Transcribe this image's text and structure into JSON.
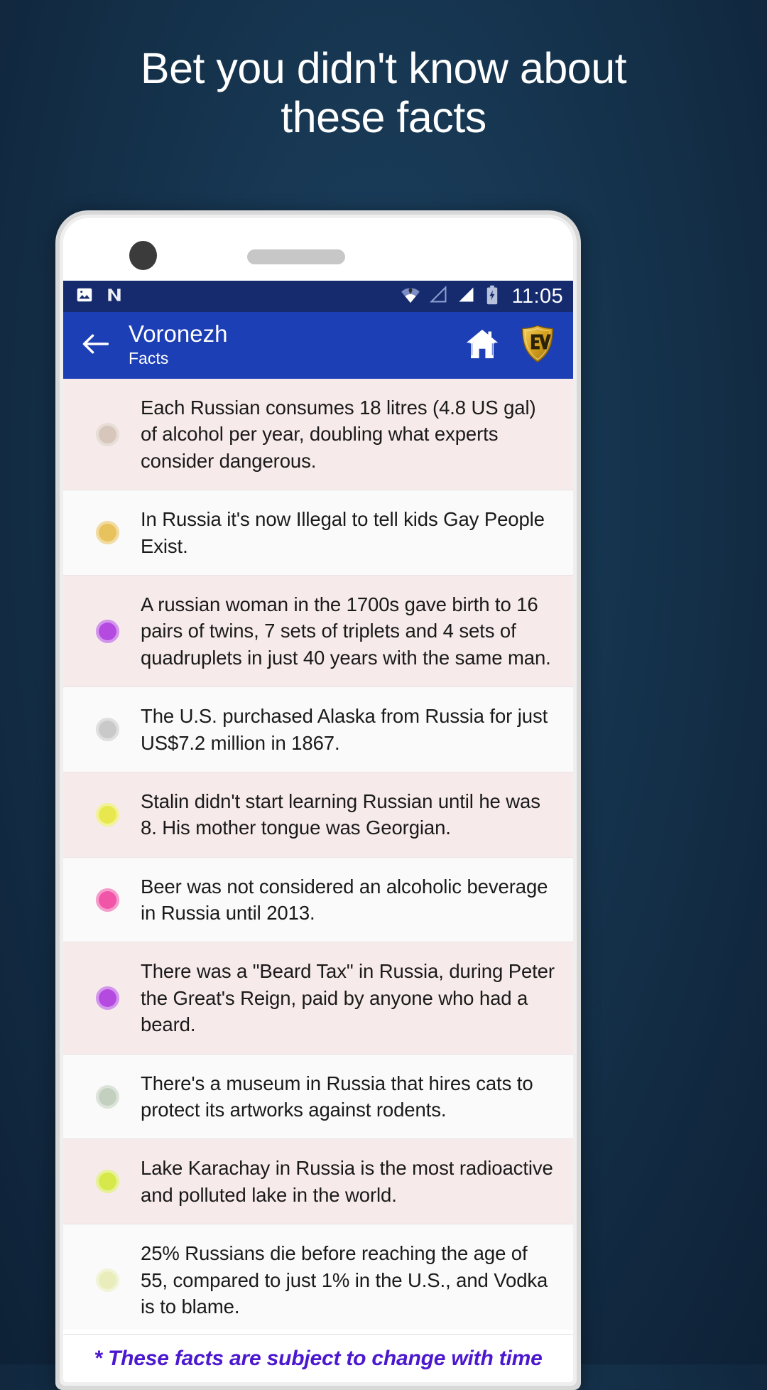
{
  "promo": {
    "line1": "Bet you didn't know about",
    "line2": "these facts"
  },
  "colors": {
    "page_background": "#143049",
    "status_bar": "#152b6e",
    "app_bar": "#1d3fb5",
    "row_tint": "#f7eaea",
    "row_plain": "#fafafa",
    "footer_text": "#4b18cf",
    "logo_gold": "#d9a520"
  },
  "device": {
    "camera_icon": "front-camera-dot",
    "speaker_icon": "earpiece-speaker"
  },
  "status_bar": {
    "left_icons": [
      "image-icon",
      "nova-launcher-icon"
    ],
    "right_icons": [
      "wifi-icon",
      "signal-empty-icon",
      "signal-full-icon",
      "battery-charging-icon"
    ],
    "clock": "11:05"
  },
  "app_bar": {
    "back_icon": "back-arrow-icon",
    "title": "Voronezh",
    "subtitle": "Facts",
    "home_icon": "home-icon",
    "logo_icon": "ev-shield-logo",
    "logo_text": "EV"
  },
  "facts": [
    {
      "dot": "#d6c6bb",
      "text": "Each Russian consumes 18 litres (4.8 US gal) of alcohol per year, doubling what experts consider dangerous."
    },
    {
      "dot": "#e8c25c",
      "text": "In Russia it's now Illegal to tell kids Gay People Exist."
    },
    {
      "dot": "#b44ae0",
      "text": "A russian woman in the 1700s gave birth to 16 pairs of twins, 7 sets of triplets and 4 sets of quadruplets in just 40 years with the same man."
    },
    {
      "dot": "#c9c9c9",
      "text": "The U.S. purchased Alaska from Russia for just US$7.2 million in 1867."
    },
    {
      "dot": "#e8e84e",
      "text": "Stalin didn't start learning Russian until he was 8. His mother tongue was Georgian."
    },
    {
      "dot": "#f055a8",
      "text": "Beer was not considered an alcoholic beverage in Russia until 2013."
    },
    {
      "dot": "#b44ae0",
      "text": "There was a \"Beard Tax\" in Russia, during Peter the Great's Reign, paid by anyone who had a beard."
    },
    {
      "dot": "#c3d0c0",
      "text": "There's a museum in Russia that hires cats to protect its artworks against rodents."
    },
    {
      "dot": "#d6e84a",
      "text": "Lake Karachay in Russia is the most radioactive and polluted lake in the world."
    },
    {
      "dot": "#e9edbb",
      "text": "25% Russians die before reaching the age of 55, compared to just 1% in the U.S., and Vodka is to blame."
    }
  ],
  "footer": {
    "note": "* These facts are subject to change with time"
  }
}
